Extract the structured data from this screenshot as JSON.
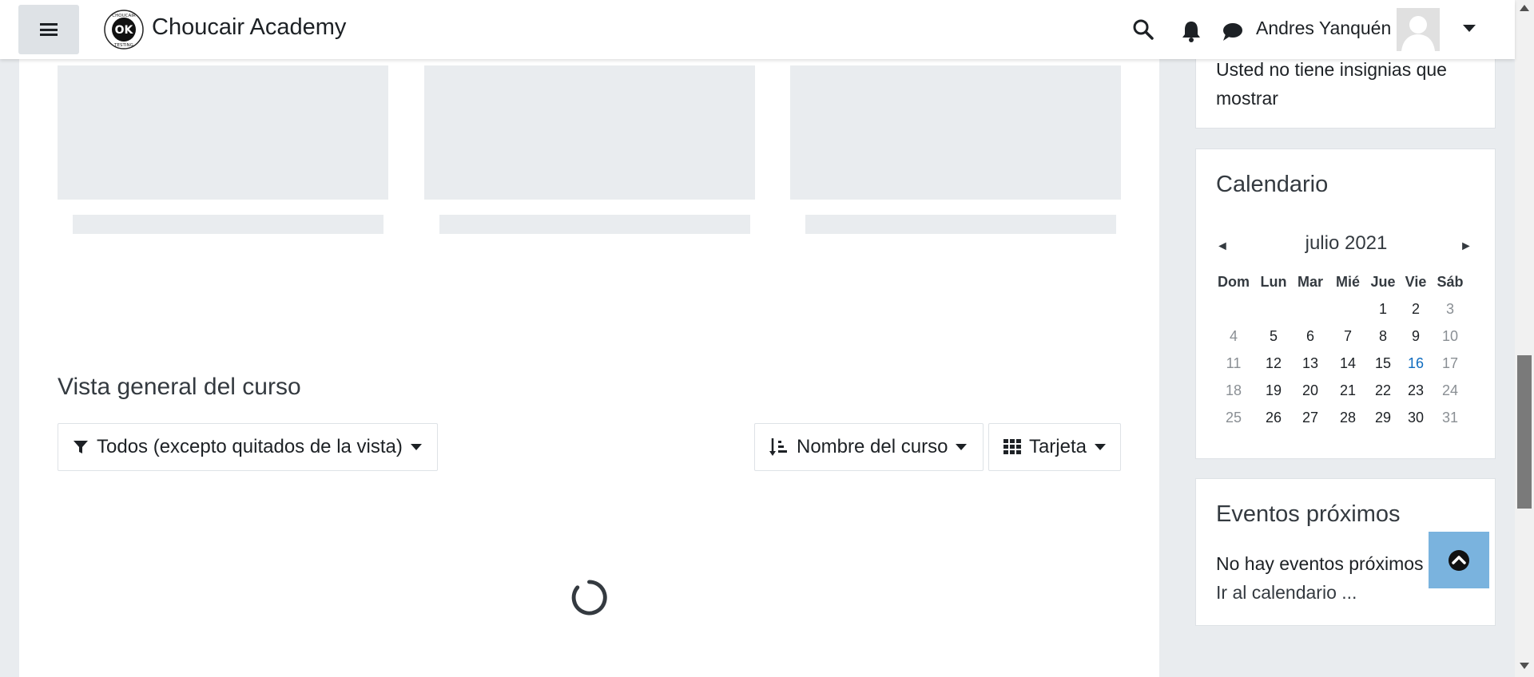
{
  "navbar": {
    "site_name": "Choucair Academy",
    "user_name": "Andres Yanquén",
    "logo_text_top": "CHOUCAIR",
    "logo_text_bottom": "TESTING",
    "logo_mark": "OK"
  },
  "badges_block": {
    "text": "Usted no tiene insignias que mostrar"
  },
  "calendar_block": {
    "title": "Calendario",
    "month_label": "julio 2021",
    "prev_arrow": "◄",
    "next_arrow": "►",
    "weekdays": [
      "Dom",
      "Lun",
      "Mar",
      "Mié",
      "Jue",
      "Vie",
      "Sáb"
    ],
    "weeks": [
      [
        "",
        "",
        "",
        "",
        "1",
        "2",
        "3"
      ],
      [
        "4",
        "5",
        "6",
        "7",
        "8",
        "9",
        "10"
      ],
      [
        "11",
        "12",
        "13",
        "14",
        "15",
        "16",
        "17"
      ],
      [
        "18",
        "19",
        "20",
        "21",
        "22",
        "23",
        "24"
      ],
      [
        "25",
        "26",
        "27",
        "28",
        "29",
        "30",
        "31"
      ]
    ],
    "today": "16"
  },
  "events_block": {
    "title": "Eventos próximos",
    "empty_text": "No hay eventos próximos",
    "link": "Ir al calendario ..."
  },
  "course_overview": {
    "title": "Vista general del curso",
    "filter_label": "Todos (excepto quitados de la vista)",
    "sort_label": "Nombre del curso",
    "view_label": "Tarjeta"
  },
  "colors": {
    "accent": "#0f6cbf",
    "page_bg": "#e9ecef",
    "scroll_top_bg": "#7ab3de"
  },
  "icons": [
    "hamburger-icon",
    "search-icon",
    "bell-icon",
    "chat-icon",
    "caret-down-icon",
    "filter-icon",
    "sort-icon",
    "grid-icon",
    "spinner-icon",
    "chevron-up-icon"
  ]
}
